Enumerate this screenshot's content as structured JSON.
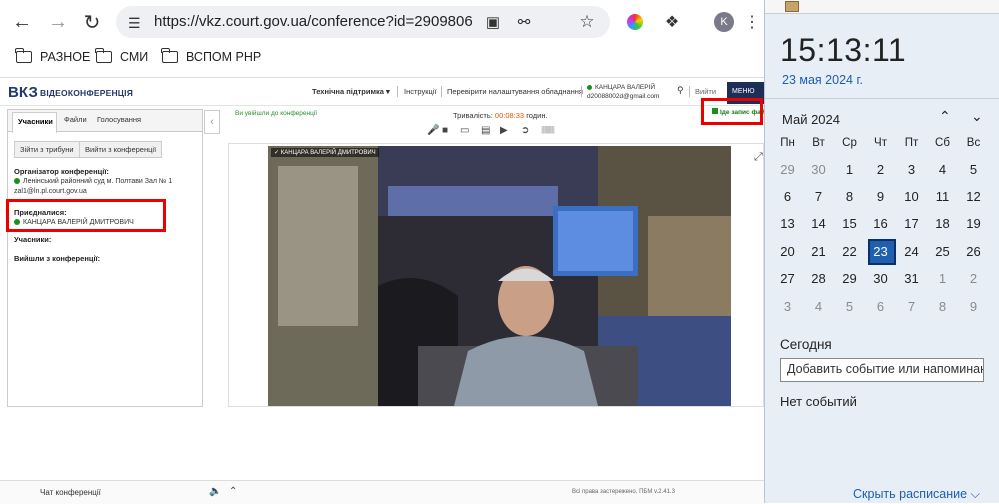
{
  "browser": {
    "url": "https://vkz.court.gov.ua/conference?id=2909806",
    "profile_initial": "K",
    "bookmarks": [
      "РАЗНОЕ",
      "СМИ",
      "ВСПОМ РНР"
    ]
  },
  "page": {
    "logo": "ВКЗ",
    "logo_sub": "ВІДЕОКОНФЕРЕНЦІЯ",
    "header_links": [
      "Технічна підтримка ▾",
      "Інструкції",
      "Перевірити налаштування обладнання"
    ],
    "user_name": "КАНЦАРА ВАЛЕРІЙ",
    "user_email": "d20088002d@gmail.com",
    "exit_label": "Вийти",
    "menu_label": "МЕНЮ",
    "tabs": [
      "Учасники",
      "Файли",
      "Голосування"
    ],
    "buttons": [
      "Зійти з трибуни",
      "Вийти з конференції"
    ],
    "organizer_title": "Організатор конференції:",
    "organizer_name": "Ленінський районний суд м. Полтави Зал № 1",
    "organizer_email": "zal1@ln.pl.court.gov.ua",
    "joined_title": "Приєдналися:",
    "joined_name": "КАНЦАРА ВАЛЕРІЙ ДМИТРОВИЧ",
    "participants_title": "Учасники:",
    "left_title": "Вийшли з конференції:",
    "conf_status": "Ви увійшли до конференції",
    "duration_label": "Тривалість:",
    "duration_value": "00:08:33",
    "duration_unit": "годин.",
    "recording_label": "Іде запис фай",
    "video_label": "✓ КАНЦАРА ВАЛЕРІЙ ДМИТРОВИЧ",
    "chat_label": "Чат конференції",
    "rights": "Всі права застережено. ПБМ v.2.41.3"
  },
  "calendar": {
    "time": "15:13:11",
    "date": "23 мая 2024 г.",
    "month": "Май 2024",
    "weekdays": [
      "Пн",
      "Вт",
      "Ср",
      "Чт",
      "Пт",
      "Сб",
      "Вс"
    ],
    "weeks": [
      [
        "29",
        "30",
        "1",
        "2",
        "3",
        "4",
        "5"
      ],
      [
        "6",
        "7",
        "8",
        "9",
        "10",
        "11",
        "12"
      ],
      [
        "13",
        "14",
        "15",
        "16",
        "17",
        "18",
        "19"
      ],
      [
        "20",
        "21",
        "22",
        "23",
        "24",
        "25",
        "26"
      ],
      [
        "27",
        "28",
        "29",
        "30",
        "31",
        "1",
        "2"
      ],
      [
        "3",
        "4",
        "5",
        "6",
        "7",
        "8",
        "9"
      ]
    ],
    "today_label": "Сегодня",
    "event_placeholder": "Добавить событие или напоминание",
    "no_events": "Нет событий",
    "hide_schedule": "Скрыть расписание ⌵"
  },
  "colors": {
    "accent": "#1f5fb0",
    "highlight": "#e00000",
    "status_green": "#1a8f1a",
    "menu_bg": "#1d2f56"
  }
}
